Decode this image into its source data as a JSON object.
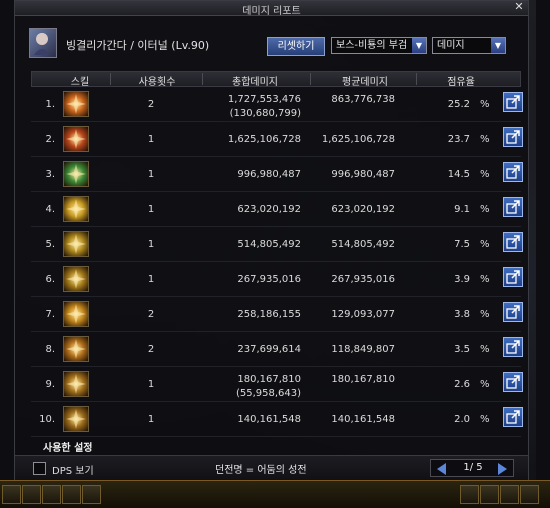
{
  "window": {
    "title": "데미지 리포트",
    "close_icon": "close-icon"
  },
  "header": {
    "player": "빙결리가간다 / 이터널 (Lv.90)",
    "reset_label": "리셋하기",
    "dungeon_select": "보스-비툥의 부검",
    "metric_select": "데미지"
  },
  "columns": {
    "skill": "스킬",
    "uses": "사용횟수",
    "total": "총합데미지",
    "avg": "평균데미지",
    "share": "점유율"
  },
  "rows": [
    {
      "rank": "1.",
      "uses": "2",
      "total": "1,727,553,476",
      "total_sub": "(130,680,799)",
      "avg": "863,776,738",
      "share": "25.2",
      "pct": "%",
      "icon": "fire-burst-icon",
      "color": "#c9641c"
    },
    {
      "rank": "2.",
      "uses": "1",
      "total": "1,625,106,728",
      "total_sub": "",
      "avg": "1,625,106,728",
      "share": "23.7",
      "pct": "%",
      "icon": "flame-ring-icon",
      "color": "#b8451a"
    },
    {
      "rank": "3.",
      "uses": "1",
      "total": "996,980,487",
      "total_sub": "",
      "avg": "996,980,487",
      "share": "14.5",
      "pct": "%",
      "icon": "green-burst-icon",
      "color": "#3f8a36"
    },
    {
      "rank": "4.",
      "uses": "1",
      "total": "623,020,192",
      "total_sub": "",
      "avg": "623,020,192",
      "share": "9.1",
      "pct": "%",
      "icon": "lightning-icon",
      "color": "#c79a22"
    },
    {
      "rank": "5.",
      "uses": "1",
      "total": "514,805,492",
      "total_sub": "",
      "avg": "514,805,492",
      "share": "7.5",
      "pct": "%",
      "icon": "spike-burst-icon",
      "color": "#b08a1f"
    },
    {
      "rank": "6.",
      "uses": "1",
      "total": "267,935,016",
      "total_sub": "",
      "avg": "267,935,016",
      "share": "3.9",
      "pct": "%",
      "icon": "spark-icon",
      "color": "#a47a1a"
    },
    {
      "rank": "7.",
      "uses": "2",
      "total": "258,186,155",
      "total_sub": "",
      "avg": "129,093,077",
      "share": "3.8",
      "pct": "%",
      "icon": "star-burst-icon",
      "color": "#c3861c"
    },
    {
      "rank": "8.",
      "uses": "2",
      "total": "237,699,614",
      "total_sub": "",
      "avg": "118,849,807",
      "share": "3.5",
      "pct": "%",
      "icon": "slash-icon",
      "color": "#b06d1a"
    },
    {
      "rank": "9.",
      "uses": "1",
      "total": "180,167,810",
      "total_sub": "(55,958,643)",
      "avg": "180,167,810",
      "share": "2.6",
      "pct": "%",
      "icon": "wave-slash-icon",
      "color": "#a6721d"
    },
    {
      "rank": "10.",
      "uses": "1",
      "total": "140,161,548",
      "total_sub": "",
      "avg": "140,161,548",
      "share": "2.0",
      "pct": "%",
      "icon": "claw-icon",
      "color": "#9a6a1a"
    }
  ],
  "used_settings": "사용한 설정",
  "footer": {
    "dps_label": "DPS 보기",
    "dungeon": "던전명 = 어둠의 성전",
    "page": "1/ 5"
  }
}
